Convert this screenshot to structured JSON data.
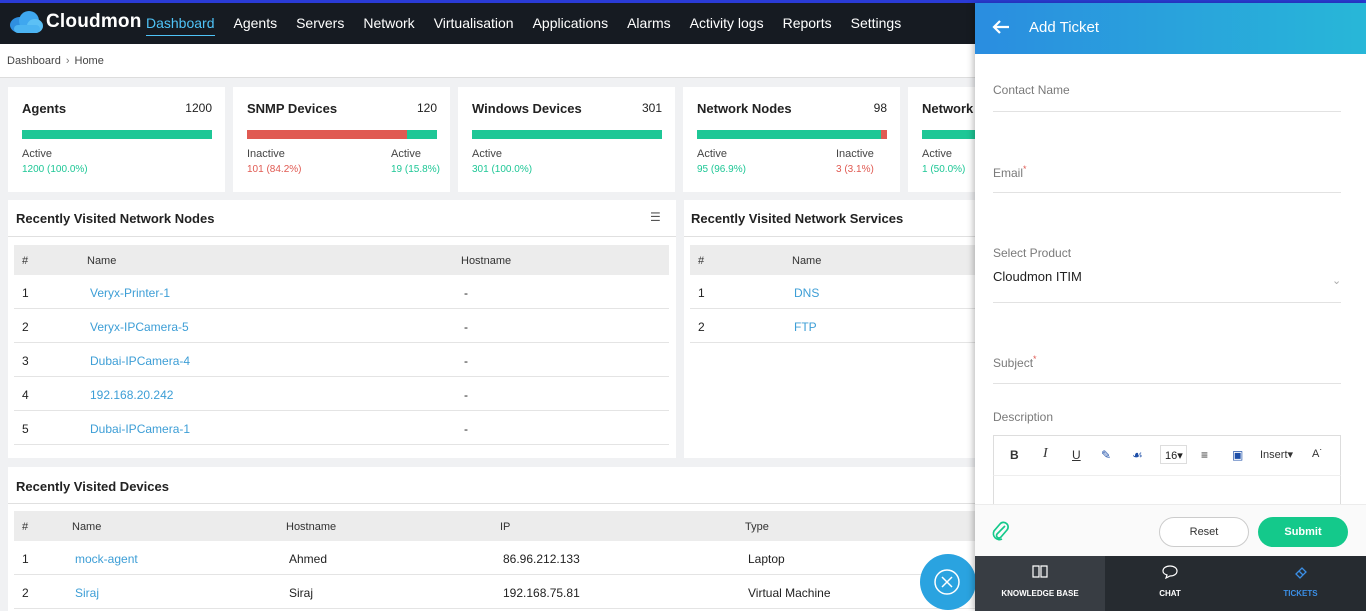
{
  "app": {
    "name": "Cloudmon"
  },
  "nav": [
    "Dashboard",
    "Agents",
    "Servers",
    "Network",
    "Virtualisation",
    "Applications",
    "Alarms",
    "Activity logs",
    "Reports",
    "Settings"
  ],
  "breadcrumb": [
    "Dashboard",
    "Home"
  ],
  "cards": [
    {
      "title": "Agents",
      "count": "1200",
      "bar": [
        {
          "color": "#1ec796",
          "pct": 100
        }
      ],
      "stats": [
        {
          "label": "Active",
          "value": "1200 (100.0%)",
          "cls": "g"
        }
      ]
    },
    {
      "title": "SNMP Devices",
      "count": "120",
      "bar": [
        {
          "color": "#e05a52",
          "pct": 84.2
        },
        {
          "color": "#1ec796",
          "pct": 15.8
        }
      ],
      "stats": [
        {
          "label": "Inactive",
          "value": "101 (84.2%)",
          "cls": "r"
        },
        {
          "label": "Active",
          "value": "19 (15.8%)",
          "cls": "g"
        }
      ]
    },
    {
      "title": "Windows Devices",
      "count": "301",
      "bar": [
        {
          "color": "#1ec796",
          "pct": 100
        }
      ],
      "stats": [
        {
          "label": "Active",
          "value": "301 (100.0%)",
          "cls": "g"
        }
      ]
    },
    {
      "title": "Network Nodes",
      "count": "98",
      "bar": [
        {
          "color": "#1ec796",
          "pct": 96.9
        },
        {
          "color": "#e05a52",
          "pct": 3.1
        }
      ],
      "stats": [
        {
          "label": "Active",
          "value": "95 (96.9%)",
          "cls": "g"
        },
        {
          "label": "Inactive",
          "value": "3 (3.1%)",
          "cls": "r"
        }
      ]
    },
    {
      "title": "Network",
      "count": "",
      "bar": [
        {
          "color": "#1ec796",
          "pct": 100
        }
      ],
      "stats": [
        {
          "label": "Active",
          "value": "1 (50.0%)",
          "cls": "g"
        }
      ]
    }
  ],
  "nodes_panel": {
    "title": "Recently Visited Network Nodes",
    "cols": [
      "#",
      "Name",
      "Hostname"
    ],
    "rows": [
      [
        "1",
        "Veryx-Printer-1",
        "-"
      ],
      [
        "2",
        "Veryx-IPCamera-5",
        "-"
      ],
      [
        "3",
        "Dubai-IPCamera-4",
        "-"
      ],
      [
        "4",
        "192.168.20.242",
        "-"
      ],
      [
        "5",
        "Dubai-IPCamera-1",
        "-"
      ]
    ]
  },
  "services_panel": {
    "title": "Recently Visited Network Services",
    "cols": [
      "#",
      "Name"
    ],
    "rows": [
      [
        "1",
        "DNS"
      ],
      [
        "2",
        "FTP"
      ]
    ]
  },
  "devices_panel": {
    "title": "Recently Visited Devices",
    "cols": [
      "#",
      "Name",
      "Hostname",
      "IP",
      "Type"
    ],
    "rows": [
      [
        "1",
        "mock-agent",
        "Ahmed",
        "86.96.212.133",
        "Laptop"
      ],
      [
        "2",
        "Siraj",
        "Siraj",
        "192.168.75.81",
        "Virtual Machine"
      ]
    ]
  },
  "ticket": {
    "title": "Add Ticket",
    "contact_label": "Contact Name",
    "email_label": "Email",
    "product_label": "Select Product",
    "product_value": "Cloudmon ITIM",
    "subject_label": "Subject",
    "required_mark": "*",
    "description_label": "Description",
    "font_size": "16",
    "insert_label": "Insert",
    "reset_label": "Reset",
    "submit_label": "Submit"
  },
  "bottom_tabs": [
    {
      "label": "KNOWLEDGE BASE"
    },
    {
      "label": "CHAT"
    },
    {
      "label": "TICKETS"
    }
  ],
  "colors": {
    "accent": "#4fc3f7",
    "active": "#1ec796",
    "inactive": "#e05a52",
    "link": "#3d9ed6",
    "submit": "#14c98b"
  }
}
